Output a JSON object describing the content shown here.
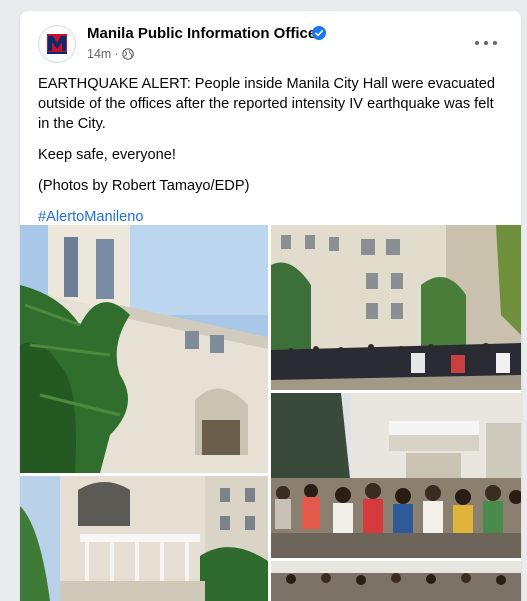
{
  "post": {
    "page_name": "Manila Public Information Office",
    "timestamp": "14m",
    "separator": "·",
    "text": {
      "paragraph1": "EARTHQUAKE ALERT: People inside Manila City Hall were evacuated outside of the offices after the reported intensity IV earthquake was felt in the City.",
      "paragraph2": "Keep safe, everyone!",
      "paragraph3": "(Photos by Robert Tamayo/EDP)",
      "hashtag": "#AlertoManileno"
    },
    "icons": {
      "verified": "verified-badge-icon",
      "audience": "globe-icon",
      "more": "more-options-icon"
    },
    "colors": {
      "name": "#050505",
      "meta": "#65676b",
      "link": "#216fdb",
      "verified": "#1877f2",
      "background": "#e9ebee"
    }
  }
}
